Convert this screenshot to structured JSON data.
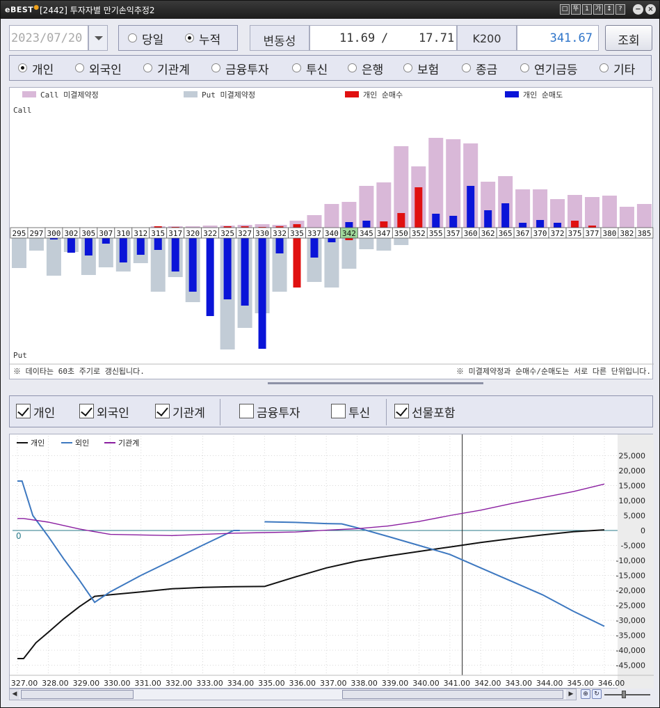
{
  "window": {
    "logo": "eBEST",
    "title": "[2442] 투자자별 만기손익추정2",
    "titlebar_buttons": [
      "□",
      "뚜",
      "1",
      "가",
      "↕",
      "?"
    ]
  },
  "toolbar": {
    "date_value": "2023/07/20",
    "mode_options": [
      {
        "label": "당일",
        "selected": false
      },
      {
        "label": "누적",
        "selected": true
      }
    ],
    "volatility_label": "변동성",
    "volatility_call": "11.69",
    "volatility_sep": "/",
    "volatility_put": "17.71",
    "k200_label": "K200",
    "k200_value": "341.67",
    "query_label": "조회"
  },
  "investor_radios": [
    {
      "label": "개인",
      "selected": true
    },
    {
      "label": "외국인",
      "selected": false
    },
    {
      "label": "기관계",
      "selected": false
    },
    {
      "label": "금융투자",
      "selected": false
    },
    {
      "label": "투신",
      "selected": false
    },
    {
      "label": "은행",
      "selected": false
    },
    {
      "label": "보험",
      "selected": false
    },
    {
      "label": "종금",
      "selected": false
    },
    {
      "label": "연기금등",
      "selected": false
    },
    {
      "label": "기타",
      "selected": false
    }
  ],
  "checkboxes": [
    {
      "label": "개인",
      "checked": true
    },
    {
      "label": "외국인",
      "checked": true
    },
    {
      "label": "기관계",
      "checked": true
    },
    {
      "label": "금융투자",
      "checked": false
    },
    {
      "label": "투신",
      "checked": false
    },
    {
      "label": "선물포함",
      "checked": true
    }
  ],
  "colors": {
    "call_oi": "#d9b8d8",
    "put_oi": "#c2ccd6",
    "net_buy": "#e01010",
    "net_sell": "#0a14d8",
    "atm_strike": "#9fd89a",
    "line_personal": "#111111",
    "line_foreign": "#3d78c0",
    "line_institution": "#8a1ea0",
    "zero_line": "#2a7a8a"
  },
  "chart_data": [
    {
      "type": "bar",
      "legend": [
        "Call 미결제약정",
        "Put 미결제약정",
        "개인 순매수",
        "개인 순매도"
      ],
      "top_label": "Call",
      "bottom_label": "Put",
      "footer_left": "※ 데이타는 60초 주기로 갱신됩니다.",
      "footer_right": "※ 미결제약정과 순매수/순매도는 서로 다른 단위입니다.",
      "atm_strike": "342",
      "categories": [
        "295",
        "297",
        "300",
        "302",
        "305",
        "307",
        "310",
        "312",
        "315",
        "317",
        "320",
        "322",
        "325",
        "327",
        "330",
        "332",
        "335",
        "337",
        "340",
        "342",
        "345",
        "347",
        "350",
        "352",
        "355",
        "357",
        "360",
        "362",
        "365",
        "367",
        "370",
        "372",
        "375",
        "377",
        "380",
        "382",
        "385"
      ],
      "call_oi": [
        0,
        0,
        0,
        0,
        0,
        0,
        0,
        0,
        2,
        2,
        2,
        3,
        3,
        4,
        5,
        4,
        10,
        18,
        34,
        37,
        60,
        65,
        117,
        88,
        129,
        127,
        121,
        66,
        74,
        55,
        55,
        41,
        47,
        44,
        46,
        30,
        34
      ],
      "call_net": [
        0,
        0,
        0,
        0,
        0,
        0,
        0,
        0,
        2,
        1,
        0,
        0,
        2,
        2,
        1,
        2,
        5,
        0,
        0,
        8,
        10,
        9,
        21,
        58,
        20,
        17,
        60,
        25,
        35,
        7,
        11,
        7,
        10,
        3,
        0,
        0,
        0
      ],
      "put_oi": [
        43,
        18,
        54,
        20,
        53,
        42,
        48,
        36,
        77,
        56,
        92,
        0,
        160,
        129,
        108,
        77,
        0,
        63,
        71,
        44,
        16,
        18,
        10,
        0,
        0,
        0,
        0,
        0,
        0,
        0,
        0,
        0,
        0,
        0,
        0,
        0,
        0
      ],
      "put_net": [
        0,
        0,
        2,
        21,
        25,
        8,
        35,
        24,
        17,
        48,
        77,
        112,
        88,
        97,
        159,
        22,
        71,
        28,
        6,
        3,
        0,
        0,
        0,
        0,
        0,
        0,
        0,
        0,
        0,
        0,
        0,
        0,
        0,
        0,
        0,
        0,
        0
      ],
      "put_net_is_buy": [
        false,
        false,
        false,
        false,
        false,
        false,
        false,
        false,
        false,
        false,
        false,
        false,
        false,
        false,
        false,
        false,
        true,
        false,
        false,
        true,
        false,
        false,
        false,
        false,
        false,
        false,
        false,
        false,
        false,
        false,
        false,
        false,
        false,
        false,
        false,
        false,
        false
      ]
    },
    {
      "type": "line",
      "legend": [
        "개인",
        "외인",
        "기관계"
      ],
      "zero_label": "0",
      "x_ticks": [
        "327.00",
        "328.00",
        "329.00",
        "330.00",
        "331.00",
        "332.00",
        "333.00",
        "334.00",
        "335.00",
        "336.00",
        "337.00",
        "338.00",
        "339.00",
        "340.00",
        "341.00",
        "342.00",
        "343.00",
        "344.00",
        "345.00",
        "346.00"
      ],
      "y_ticks": [
        "25,000",
        "20,000",
        "15,000",
        "10,000",
        "5,000",
        "0",
        "-5,000",
        "-10,000",
        "-15,000",
        "-20,000",
        "-25,000",
        "-30,000",
        "-35,000",
        "-40,000",
        "-45,000"
      ],
      "ylim": [
        -47000,
        27000
      ],
      "xlim": [
        327,
        346
      ],
      "cursor_x": 341.4,
      "series": [
        {
          "name": "개인",
          "points": [
            [
              327,
              -42800
            ],
            [
              327.2,
              -42800
            ],
            [
              327.6,
              -37500
            ],
            [
              328,
              -34000
            ],
            [
              328.5,
              -29500
            ],
            [
              329,
              -25500
            ],
            [
              329.5,
              -22000
            ],
            [
              330,
              -21500
            ],
            [
              331,
              -20500
            ],
            [
              332,
              -19500
            ],
            [
              333,
              -19000
            ],
            [
              334,
              -18800
            ],
            [
              335,
              -18700
            ],
            [
              336,
              -15500
            ],
            [
              337,
              -12500
            ],
            [
              338,
              -10200
            ],
            [
              339,
              -8500
            ],
            [
              340,
              -7000
            ],
            [
              341,
              -5500
            ],
            [
              342,
              -4000
            ],
            [
              343,
              -2700
            ],
            [
              344,
              -1500
            ],
            [
              345,
              -400
            ],
            [
              346,
              200
            ]
          ]
        },
        {
          "name": "외인",
          "points": [
            [
              327,
              16500
            ],
            [
              327.15,
              16500
            ],
            [
              327.5,
              5000
            ],
            [
              328,
              -2000
            ],
            [
              328.5,
              -9500
            ],
            [
              329,
              -16500
            ],
            [
              329.5,
              -24000
            ],
            [
              330,
              -20500
            ],
            [
              331,
              -15000
            ],
            [
              332,
              -10000
            ],
            [
              333,
              -4900
            ],
            [
              334,
              0
            ],
            [
              334.2,
              0
            ]
          ]
        },
        {
          "name": "외인",
          "points": [
            [
              335,
              2900
            ],
            [
              336,
              2700
            ],
            [
              337,
              2300
            ],
            [
              337.5,
              2200
            ],
            [
              338,
              900
            ],
            [
              339,
              -2000
            ],
            [
              340,
              -5000
            ],
            [
              341,
              -8000
            ],
            [
              342,
              -12500
            ],
            [
              343,
              -17000
            ],
            [
              344,
              -21500
            ],
            [
              345,
              -27000
            ],
            [
              346,
              -32000
            ]
          ]
        },
        {
          "name": "기관계",
          "points": [
            [
              327,
              4000
            ],
            [
              327.2,
              4000
            ],
            [
              328,
              2800
            ],
            [
              329,
              500
            ],
            [
              330,
              -1300
            ],
            [
              331,
              -1500
            ],
            [
              332,
              -1700
            ],
            [
              333,
              -1300
            ],
            [
              334,
              -900
            ],
            [
              335,
              -700
            ],
            [
              336,
              -500
            ],
            [
              337,
              100
            ],
            [
              338,
              600
            ],
            [
              339,
              1500
            ],
            [
              340,
              3000
            ],
            [
              341,
              5000
            ],
            [
              342,
              6800
            ],
            [
              343,
              9000
            ],
            [
              344,
              11000
            ],
            [
              345,
              13000
            ],
            [
              346,
              15500
            ]
          ]
        }
      ]
    }
  ]
}
